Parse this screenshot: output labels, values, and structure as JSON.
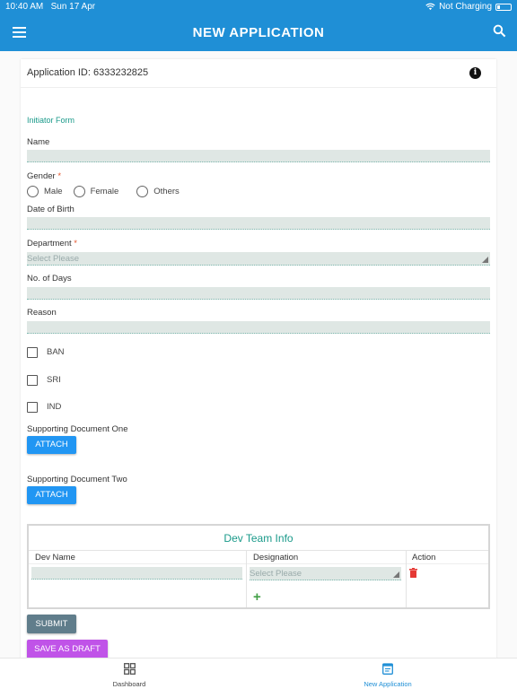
{
  "status_bar": {
    "time": "10:40 AM",
    "date": "Sun 17 Apr",
    "charging": "Not Charging"
  },
  "header": {
    "title": "NEW APPLICATION",
    "menu_icon": "hamburger-menu-icon",
    "search_icon": "search-icon"
  },
  "application": {
    "id_text": "Application ID: 6333232825",
    "info_icon": "info-icon"
  },
  "form": {
    "section_title": "Initiator Form",
    "name_label": "Name",
    "gender_label": "Gender",
    "required_mark": "*",
    "gender_options": [
      "Male",
      "Female",
      "Others"
    ],
    "dob_label": "Date of Birth",
    "department_label": "Department",
    "department_placeholder": "Select Please",
    "days_label": "No. of Days",
    "reason_label": "Reason",
    "checkboxes": [
      "BAN",
      "SRI",
      "IND"
    ],
    "doc_one_label": "Supporting Document One",
    "doc_two_label": "Supporting Document Two",
    "attach_label": "ATTACH"
  },
  "dev_team": {
    "title": "Dev Team Info",
    "columns": [
      "Dev Name",
      "Designation",
      "Action"
    ],
    "designation_placeholder": "Select Please",
    "add_symbol": "+"
  },
  "actions": {
    "submit_label": "SUBMIT",
    "draft_label": "SAVE AS DRAFT"
  },
  "bottom_nav": {
    "items": [
      {
        "label": "Dashboard",
        "icon": "dashboard-icon",
        "active": false
      },
      {
        "label": "New Application",
        "icon": "application-form-icon",
        "active": true
      }
    ],
    "active_color": "#1f8fd6",
    "inactive_color": "#444444"
  },
  "colors": {
    "primary": "#1f8fd6",
    "accent_teal": "#1a9a8a",
    "button_blue": "#2196f3",
    "button_grey": "#607d8b",
    "button_purple": "#c053e8",
    "required_red": "#e4572e",
    "delete_red": "#e53935",
    "add_green": "#43a047"
  }
}
